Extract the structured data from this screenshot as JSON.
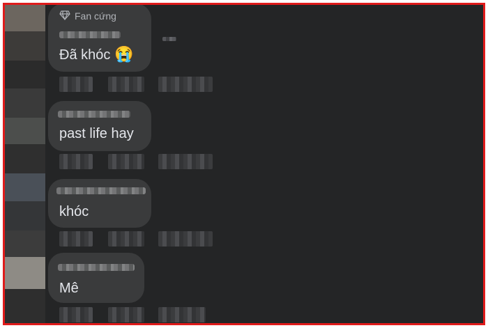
{
  "comments": [
    {
      "badge": "Fan cứng",
      "text": "Đã khóc",
      "emoji": "😭"
    },
    {
      "text": "past life hay"
    },
    {
      "text": "khóc"
    },
    {
      "text": "Mê"
    }
  ],
  "colors": {
    "frame_border": "#e01b1b",
    "background": "#242526",
    "bubble": "#3a3b3c",
    "text": "#e4e6eb"
  }
}
